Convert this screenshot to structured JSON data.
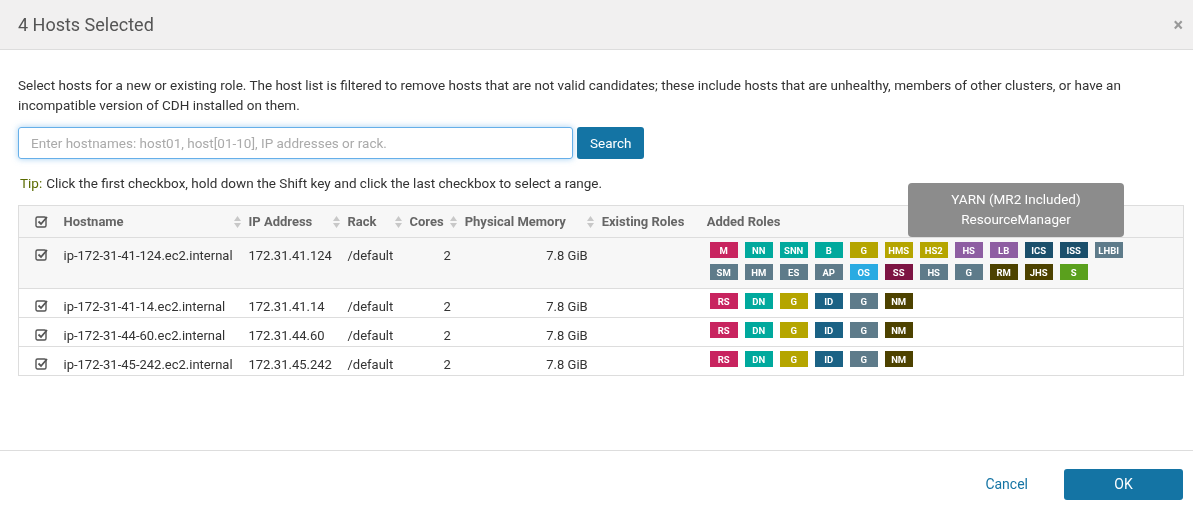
{
  "dialog": {
    "title": "4 Hosts Selected",
    "close": "×"
  },
  "description": "Select hosts for a new or existing role. The host list is filtered to remove hosts that are not valid candidates; these include hosts that are unhealthy, members of other clusters, or have an incompatible version of CDH installed on them.",
  "search": {
    "placeholder": "Enter hostnames: host01, host[01-10], IP addresses or rack.",
    "button": "Search"
  },
  "tip": {
    "label": "Tip:",
    "text": "Click the first checkbox, hold down the Shift key and click the last checkbox to select a range."
  },
  "table": {
    "select_all_checked": true,
    "columns": [
      {
        "label": "Hostname",
        "sortable": true
      },
      {
        "label": "IP Address",
        "sortable": true
      },
      {
        "label": "Rack",
        "sortable": true
      },
      {
        "label": "Cores",
        "sortable": true
      },
      {
        "label": "Physical Memory",
        "sortable": true
      },
      {
        "label": "Existing Roles",
        "sortable": false
      },
      {
        "label": "Added Roles",
        "sortable": false
      }
    ],
    "rows": [
      {
        "checked": true,
        "highlighted": true,
        "hostname": "ip-172-31-41-124.ec2.internal",
        "ip": "172.31.41.124",
        "rack": "/default",
        "cores": "2",
        "memory": "7.8 GiB",
        "roles": [
          {
            "label": "M",
            "color": "#c8245f"
          },
          {
            "label": "NN",
            "color": "#00a99d"
          },
          {
            "label": "SNN",
            "color": "#00a99d"
          },
          {
            "label": "B",
            "color": "#00a99d"
          },
          {
            "label": "G",
            "color": "#b5a500"
          },
          {
            "label": "HMS",
            "color": "#b5a500"
          },
          {
            "label": "HS2",
            "color": "#b5a500"
          },
          {
            "label": "HS",
            "color": "#8e5ea2"
          },
          {
            "label": "LB",
            "color": "#8e5ea2"
          },
          {
            "label": "ICS",
            "color": "#1b4f6b"
          },
          {
            "label": "ISS",
            "color": "#1b4f6b"
          },
          {
            "label": "LHBI",
            "color": "#5e7b8a"
          },
          {
            "label": "SM",
            "color": "#5e7b8a"
          },
          {
            "label": "HM",
            "color": "#5e7b8a"
          },
          {
            "label": "ES",
            "color": "#5e7b8a"
          },
          {
            "label": "AP",
            "color": "#5e7b8a"
          },
          {
            "label": "OS",
            "color": "#29abe2"
          },
          {
            "label": "SS",
            "color": "#7d1443"
          },
          {
            "label": "HS",
            "color": "#5e7b8a"
          },
          {
            "label": "G",
            "color": "#5e7b8a"
          },
          {
            "label": "RM",
            "color": "#4d4200"
          },
          {
            "label": "JHS",
            "color": "#4d4200"
          },
          {
            "label": "S",
            "color": "#5aa01d"
          }
        ]
      },
      {
        "checked": true,
        "highlighted": false,
        "hostname": "ip-172-31-41-14.ec2.internal",
        "ip": "172.31.41.14",
        "rack": "/default",
        "cores": "2",
        "memory": "7.8 GiB",
        "roles": [
          {
            "label": "RS",
            "color": "#c8245f"
          },
          {
            "label": "DN",
            "color": "#00a99d"
          },
          {
            "label": "G",
            "color": "#b5a500"
          },
          {
            "label": "ID",
            "color": "#1b6285"
          },
          {
            "label": "G",
            "color": "#5e7b8a"
          },
          {
            "label": "NM",
            "color": "#4d4200"
          }
        ]
      },
      {
        "checked": true,
        "highlighted": false,
        "hostname": "ip-172-31-44-60.ec2.internal",
        "ip": "172.31.44.60",
        "rack": "/default",
        "cores": "2",
        "memory": "7.8 GiB",
        "roles": [
          {
            "label": "RS",
            "color": "#c8245f"
          },
          {
            "label": "DN",
            "color": "#00a99d"
          },
          {
            "label": "G",
            "color": "#b5a500"
          },
          {
            "label": "ID",
            "color": "#1b6285"
          },
          {
            "label": "G",
            "color": "#5e7b8a"
          },
          {
            "label": "NM",
            "color": "#4d4200"
          }
        ]
      },
      {
        "checked": true,
        "highlighted": false,
        "hostname": "ip-172-31-45-242.ec2.internal",
        "ip": "172.31.45.242",
        "rack": "/default",
        "cores": "2",
        "memory": "7.8 GiB",
        "roles": [
          {
            "label": "RS",
            "color": "#c8245f"
          },
          {
            "label": "DN",
            "color": "#00a99d"
          },
          {
            "label": "G",
            "color": "#b5a500"
          },
          {
            "label": "ID",
            "color": "#1b6285"
          },
          {
            "label": "G",
            "color": "#5e7b8a"
          },
          {
            "label": "NM",
            "color": "#4d4200"
          }
        ]
      }
    ]
  },
  "tooltip": {
    "title": "YARN (MR2 Included)",
    "text": "ResourceManager"
  },
  "buttons": [
    {
      "label": "Cancel",
      "kind": "link"
    },
    {
      "label": "OK",
      "kind": "primary"
    }
  ]
}
